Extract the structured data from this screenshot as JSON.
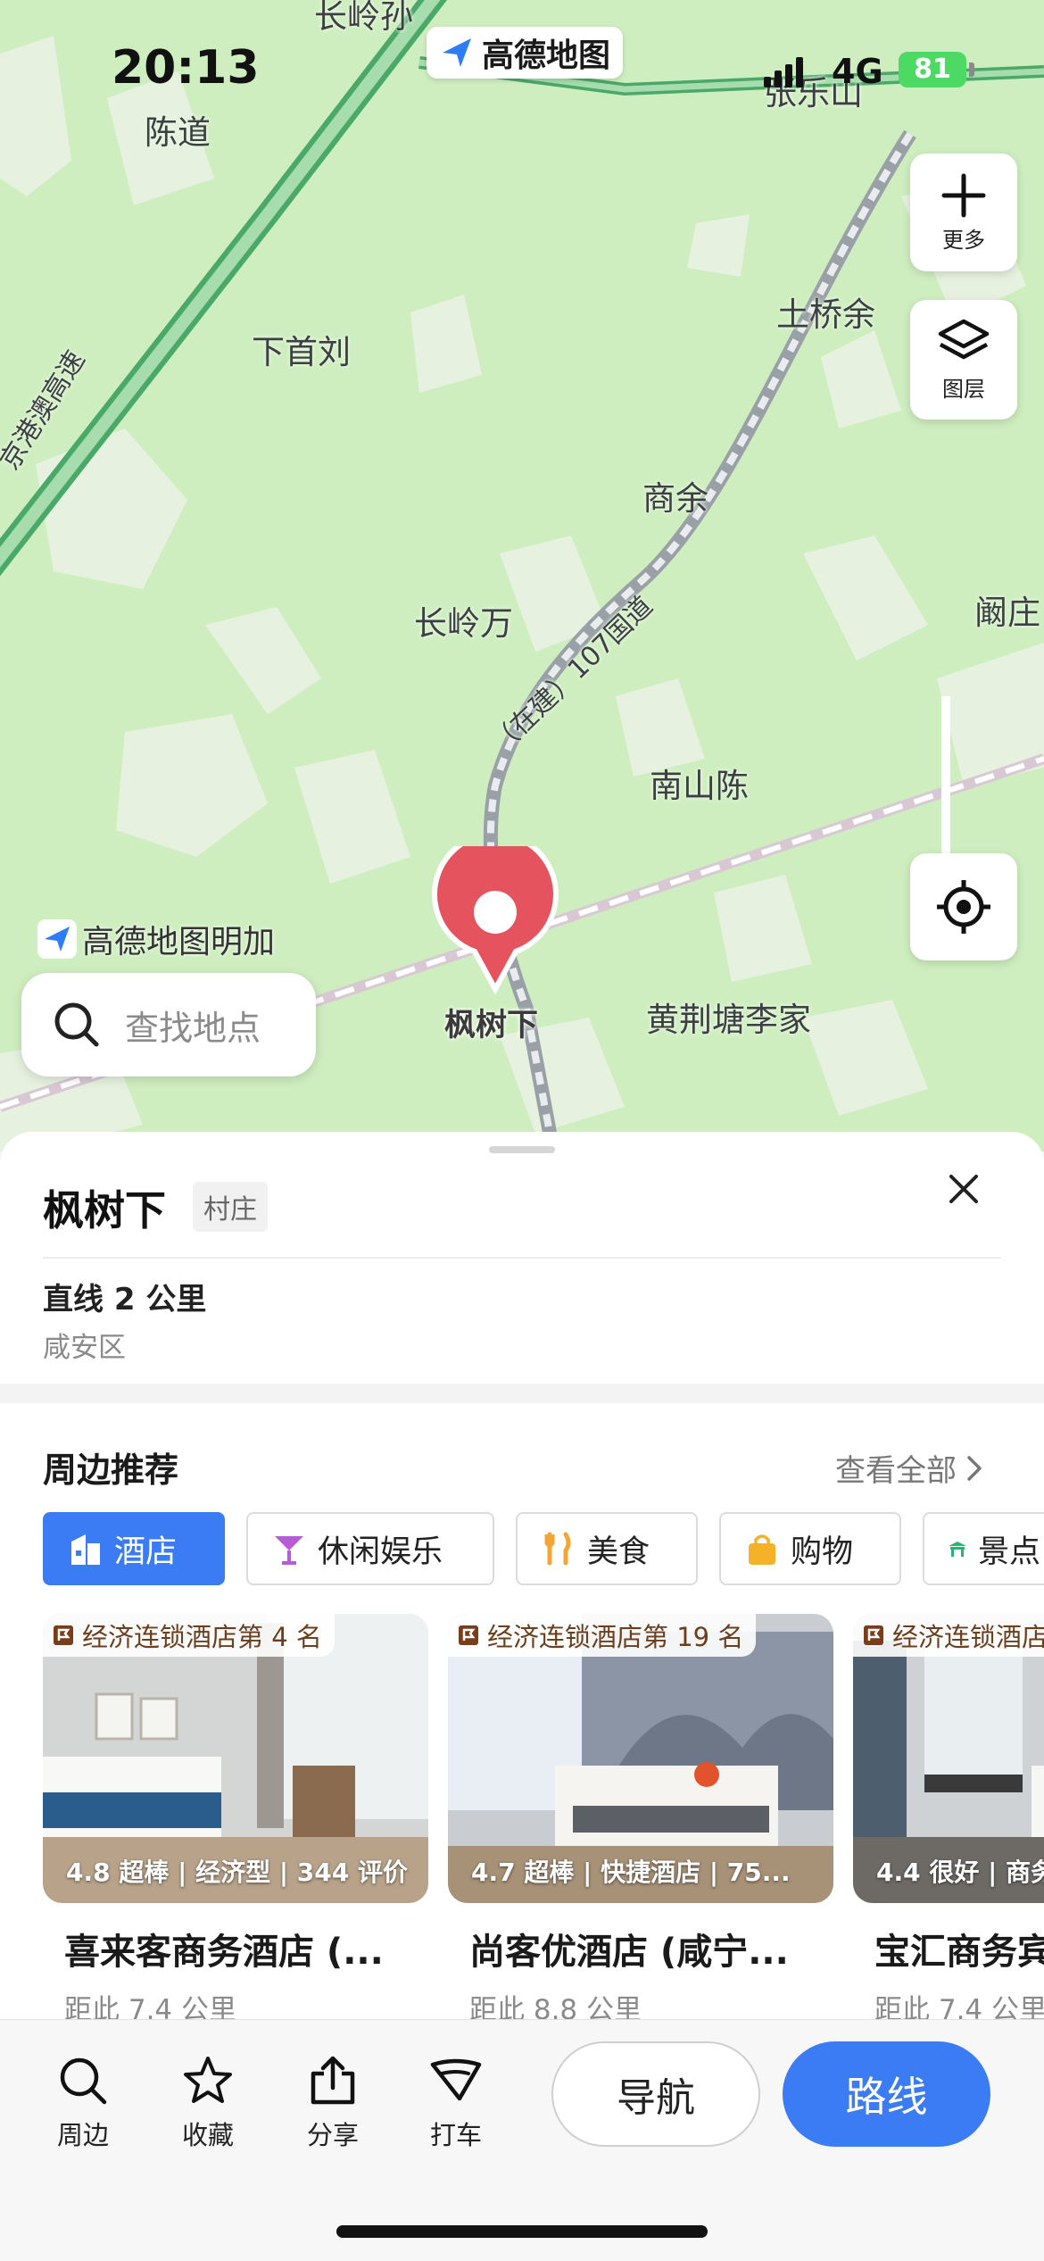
{
  "status": {
    "time": "20:13",
    "network": "4G",
    "battery": "81"
  },
  "brand": {
    "label": "高德地图"
  },
  "map": {
    "labels": [
      "长岭孙",
      "陈道",
      "张乐山",
      "土桥余",
      "下首刘",
      "京港澳高速",
      "商余",
      "长岭万",
      "阚庄",
      "（在建）107国道",
      "南山陈",
      "黄荆塘李家"
    ],
    "watermark": "高德地图明加",
    "pin_label": "枫树下",
    "controls": {
      "more": "更多",
      "layers": "图层"
    }
  },
  "search": {
    "placeholder": "查找地点"
  },
  "place": {
    "name": "枫树下",
    "type": "村庄",
    "distance": "直线 2 公里",
    "district": "咸安区"
  },
  "nearby": {
    "title": "周边推荐",
    "see_all": "查看全部",
    "categories": [
      {
        "label": "酒店",
        "icon": "hotel-icon",
        "active": true
      },
      {
        "label": "休闲娱乐",
        "icon": "cocktail-icon",
        "active": false
      },
      {
        "label": "美食",
        "icon": "food-icon",
        "active": false
      },
      {
        "label": "购物",
        "icon": "shopping-bag-icon",
        "active": false
      },
      {
        "label": "景点",
        "icon": "scenic-icon",
        "active": false
      }
    ],
    "hotels": [
      {
        "rank": "经济连锁酒店第 4 名",
        "rating": "4.8 超棒 | 经济型 | 344 评价",
        "name": "喜来客商务酒店 (...",
        "distance": "距此 7.4 公里"
      },
      {
        "rank": "经济连锁酒店第 19 名",
        "rating": "4.7 超棒 | 快捷酒店 | 75...",
        "name": "尚客优酒店 (咸宁...",
        "distance": "距此 8.8 公里"
      },
      {
        "rank": "经济连锁酒店",
        "rating": "4.4 很好 | 商务",
        "name": "宝汇商务宾",
        "distance": "距此 7.4 公里"
      }
    ]
  },
  "toolbar": {
    "nearby": "周边",
    "favorite": "收藏",
    "share": "分享",
    "taxi": "打车",
    "navigate": "导航",
    "route": "路线"
  },
  "colors": {
    "accent": "#3b7cf5",
    "map_bg": "#cfeec0",
    "pin": "#e5535e",
    "battery": "#4cd964"
  }
}
